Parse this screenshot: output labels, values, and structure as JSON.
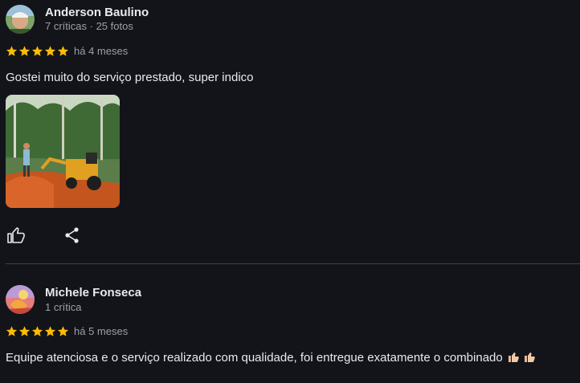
{
  "reviews": [
    {
      "name": "Anderson Baulino",
      "meta": "7 críticas · 25 fotos",
      "rating": 5,
      "when": "há 4 meses",
      "text": "Gostei muito do serviço prestado, super indico"
    },
    {
      "name": "Michele Fonseca",
      "meta": "1 crítica",
      "rating": 5,
      "when": "há 5 meses",
      "text": "Equipe atenciosa e o serviço realizado com qualidade, foi entregue exatamente o combinado"
    }
  ],
  "colors": {
    "star": "#fbbc04",
    "background": "#131419",
    "muted": "#9aa0a6"
  },
  "icons": [
    "thumbs-up-icon",
    "share-icon",
    "thumbs-up-emoji-icon"
  ]
}
